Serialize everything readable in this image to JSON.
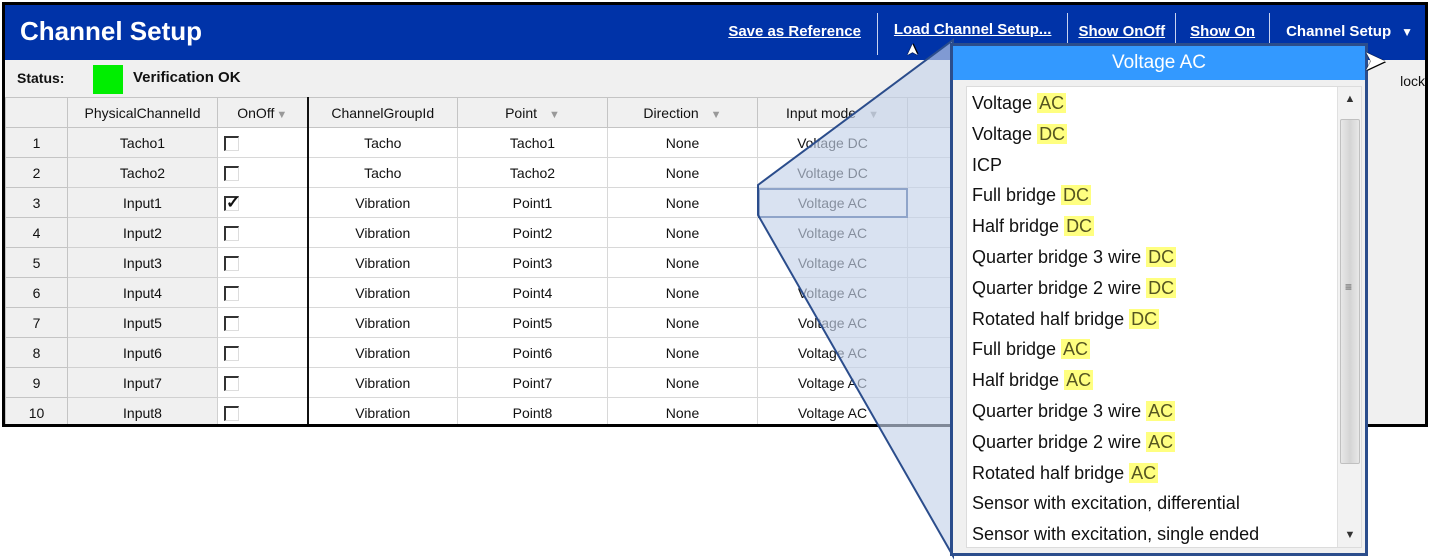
{
  "window": {
    "title": "Channel Setup",
    "toolbar": {
      "save_reference": "Save as Reference",
      "load_setup": "Load Channel Setup...",
      "show_onoff": "Show OnOff",
      "show_on": "Show On",
      "menu": "Channel Setup"
    }
  },
  "status": {
    "label": "Status:",
    "indicator_color": "#00ee00",
    "text": "Verification OK",
    "right_text": "lock"
  },
  "table": {
    "headers": [
      "",
      "PhysicalChannelId",
      "OnOff",
      "ChannelGroupId",
      "Point",
      "Direction",
      "Input mode"
    ],
    "rows": [
      {
        "n": "1",
        "phys": "Tacho1",
        "on": false,
        "group": "Tacho",
        "point": "Tacho1",
        "dir": "None",
        "mode": "Voltage DC"
      },
      {
        "n": "2",
        "phys": "Tacho2",
        "on": false,
        "group": "Tacho",
        "point": "Tacho2",
        "dir": "None",
        "mode": "Voltage DC"
      },
      {
        "n": "3",
        "phys": "Input1",
        "on": true,
        "group": "Vibration",
        "point": "Point1",
        "dir": "None",
        "mode": "Voltage AC"
      },
      {
        "n": "4",
        "phys": "Input2",
        "on": false,
        "group": "Vibration",
        "point": "Point2",
        "dir": "None",
        "mode": "Voltage AC"
      },
      {
        "n": "5",
        "phys": "Input3",
        "on": false,
        "group": "Vibration",
        "point": "Point3",
        "dir": "None",
        "mode": "Voltage AC"
      },
      {
        "n": "6",
        "phys": "Input4",
        "on": false,
        "group": "Vibration",
        "point": "Point4",
        "dir": "None",
        "mode": "Voltage AC"
      },
      {
        "n": "7",
        "phys": "Input5",
        "on": false,
        "group": "Vibration",
        "point": "Point5",
        "dir": "None",
        "mode": "Voltage AC"
      },
      {
        "n": "8",
        "phys": "Input6",
        "on": false,
        "group": "Vibration",
        "point": "Point6",
        "dir": "None",
        "mode": "Voltage AC"
      },
      {
        "n": "9",
        "phys": "Input7",
        "on": false,
        "group": "Vibration",
        "point": "Point7",
        "dir": "None",
        "mode": "Voltage AC"
      },
      {
        "n": "10",
        "phys": "Input8",
        "on": false,
        "group": "Vibration",
        "point": "Point8",
        "dir": "None",
        "mode": "Voltage AC"
      }
    ],
    "selected_row": 3
  },
  "dropdown": {
    "selected": "Voltage AC",
    "highlight_color": "#ffff80",
    "options": [
      {
        "base": "Voltage ",
        "suffix": "AC"
      },
      {
        "base": "Voltage ",
        "suffix": "DC"
      },
      {
        "base": "ICP",
        "suffix": ""
      },
      {
        "base": "Full bridge ",
        "suffix": "DC"
      },
      {
        "base": "Half bridge ",
        "suffix": "DC"
      },
      {
        "base": "Quarter bridge 3 wire ",
        "suffix": "DC"
      },
      {
        "base": "Quarter bridge 2 wire ",
        "suffix": "DC"
      },
      {
        "base": "Rotated half bridge ",
        "suffix": "DC"
      },
      {
        "base": "Full bridge ",
        "suffix": "AC"
      },
      {
        "base": "Half bridge ",
        "suffix": "AC"
      },
      {
        "base": "Quarter bridge 3 wire ",
        "suffix": "AC"
      },
      {
        "base": "Quarter bridge 2 wire ",
        "suffix": "AC"
      },
      {
        "base": "Rotated half bridge ",
        "suffix": "AC"
      },
      {
        "base": "Sensor with excitation, differential",
        "suffix": ""
      },
      {
        "base": "Sensor with excitation, single ended",
        "suffix": ""
      }
    ]
  }
}
